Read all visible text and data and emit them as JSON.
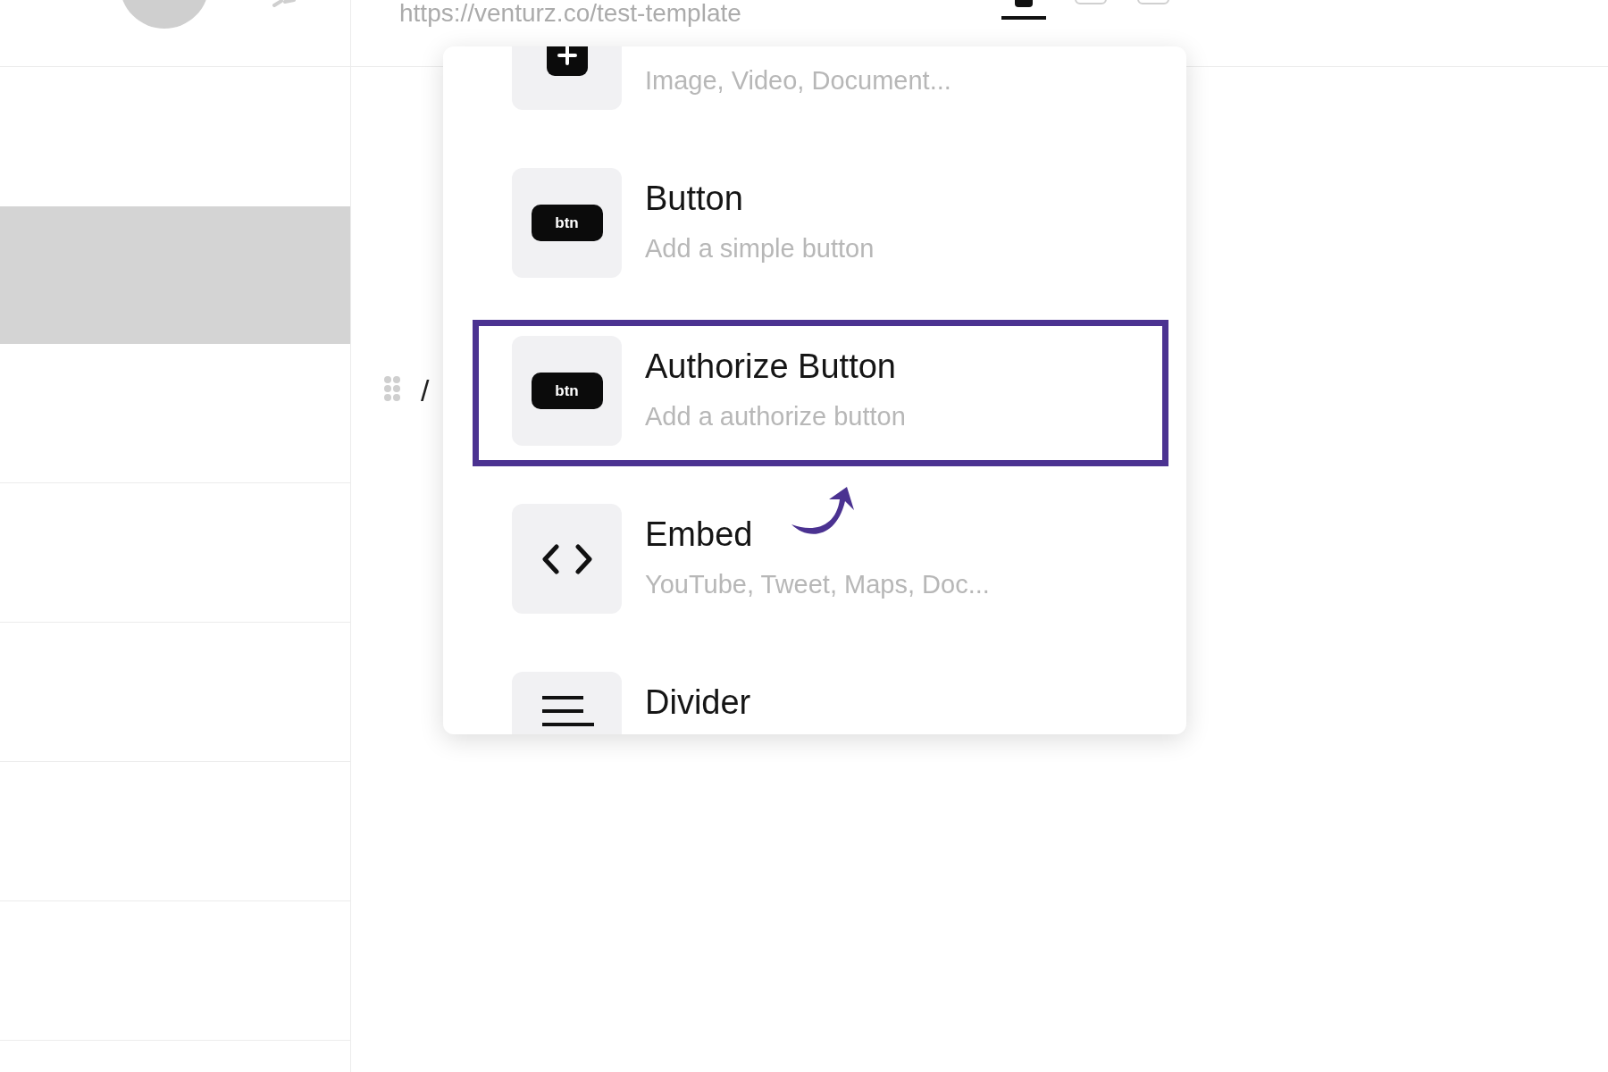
{
  "header": {
    "url": "https://venturz.co/test-template",
    "device_toggles": [
      {
        "selected": true
      },
      {
        "selected": false
      },
      {
        "selected": false
      }
    ]
  },
  "editor": {
    "slash": "/"
  },
  "menu": {
    "items": [
      {
        "kind": "upload",
        "description": "Image, Video, Document...",
        "selected": false
      },
      {
        "kind": "btn",
        "badge": "btn",
        "title": "Button",
        "description": "Add a simple button",
        "selected": false
      },
      {
        "kind": "btn",
        "badge": "btn",
        "title": "Authorize Button",
        "description": "Add a authorize button",
        "selected": true
      },
      {
        "kind": "code",
        "title": "Embed",
        "description": "YouTube, Tweet, Maps, Doc...",
        "selected": false
      },
      {
        "kind": "lines",
        "title": "Divider",
        "selected": false
      }
    ]
  }
}
